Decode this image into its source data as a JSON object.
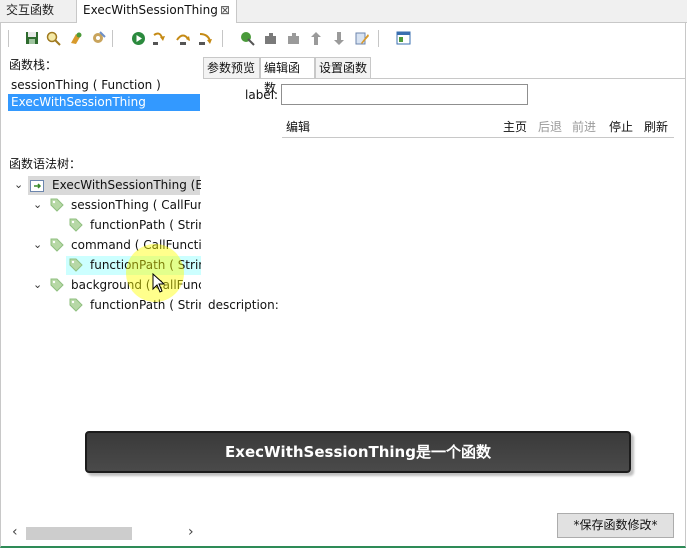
{
  "tabs": [
    {
      "label": "交互函数"
    },
    {
      "label": "ExecWithSessionThing",
      "close": "⊠"
    }
  ],
  "toolbar": {
    "icons": [
      "save-icon",
      "search-icon",
      "bug-icon",
      "tools-icon",
      "run-icon",
      "step-into-icon",
      "step-over-icon",
      "step-out-icon",
      "breakpoint-icon",
      "puzzle-icon",
      "puzzle-icon",
      "arrow-up-icon",
      "arrow-down-icon",
      "pencil-icon",
      "window-icon"
    ]
  },
  "left": {
    "stack_label": "函数栈：",
    "stack_items": [
      "sessionThing ( Function )",
      "ExecWithSessionThing"
    ],
    "tree_label": "函数语法树：",
    "tree": [
      {
        "text": "ExecWithSessionThing (Ex",
        "level": 0
      },
      {
        "text": "sessionThing ( CallFunc",
        "level": 1
      },
      {
        "text": "functionPath ( Strin",
        "level": 2
      },
      {
        "text": "command ( CallFunctic",
        "level": 1
      },
      {
        "text": "functionPath ( Strin",
        "level": 2
      },
      {
        "text": "background ( CallFunc",
        "level": 1
      },
      {
        "text": "functionPath ( Strin",
        "level": 2
      }
    ],
    "scroll_left": "‹",
    "scroll_right": "›"
  },
  "right": {
    "subtabs": [
      "参数预览",
      "编辑函数",
      "设置函数"
    ],
    "label_text": "label:",
    "label_value": "",
    "nav_title": "编辑",
    "nav": [
      {
        "label": "主页",
        "enabled": true
      },
      {
        "label": "后退",
        "enabled": false
      },
      {
        "label": "前进",
        "enabled": false
      },
      {
        "label": "停止",
        "enabled": true
      },
      {
        "label": "刷新",
        "enabled": true
      }
    ],
    "description": "description:",
    "save_button": "*保存函数修改*"
  },
  "tooltip": "ExecWithSessionThing是一个函数",
  "colors": {
    "selection": "#3399ff",
    "highlight": "#ccffff",
    "tag": "#8fbf7f"
  }
}
